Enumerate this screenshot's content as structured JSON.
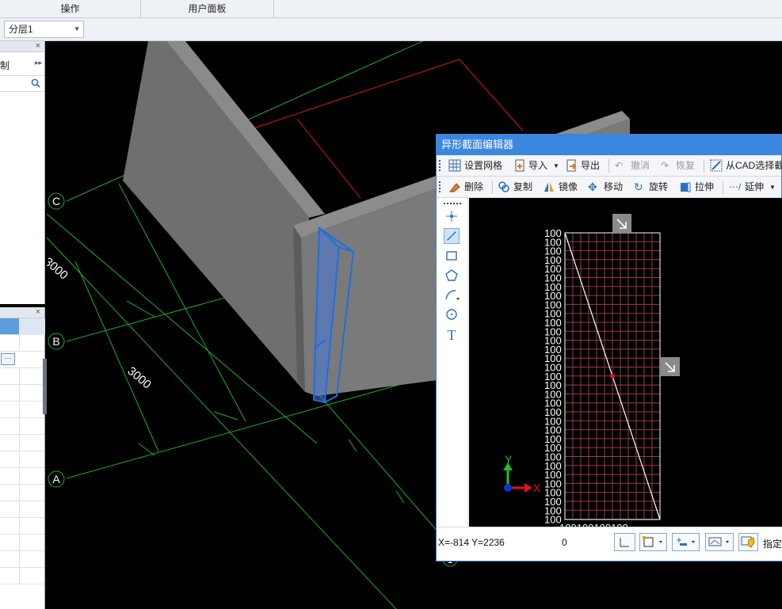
{
  "ribbon": {
    "groups": [
      "操作",
      "用户面板"
    ]
  },
  "layer_select": {
    "value": "分层1"
  },
  "left_panel": {
    "title_partial": "制",
    "close_glyph": "×"
  },
  "left_panel_bottom": {
    "close_glyph": "×",
    "dots_button": "···"
  },
  "viewport": {
    "axis_labels": {
      "a": "A",
      "b": "B",
      "c": "C",
      "bottom": "1"
    },
    "dimensions": {
      "dim1": "3000",
      "dim2": "3000"
    },
    "colors": {
      "grid": "#1fae2a",
      "wall": "#7a7a7a",
      "selected": "#1e6fe0",
      "outline": "#e0141e"
    }
  },
  "editor": {
    "title": "异形截面编辑器",
    "toolbar1": {
      "grid": "设置网格",
      "import": "导入",
      "export": "导出",
      "undo": "撤消",
      "redo": "恢复",
      "from_cad": "从CAD选择截"
    },
    "toolbar2": {
      "delete": "删除",
      "copy": "复制",
      "mirror": "镜像",
      "move": "移动",
      "rotate": "旋转",
      "stretch": "拉伸",
      "extend": "延伸"
    },
    "canvas": {
      "tick_label": "100",
      "bottom_labels": "100100100100",
      "axis_x": "X",
      "axis_y": "Y"
    },
    "status": {
      "coords": "X=-814 Y=2236",
      "value": "0",
      "assign": "指定"
    }
  }
}
